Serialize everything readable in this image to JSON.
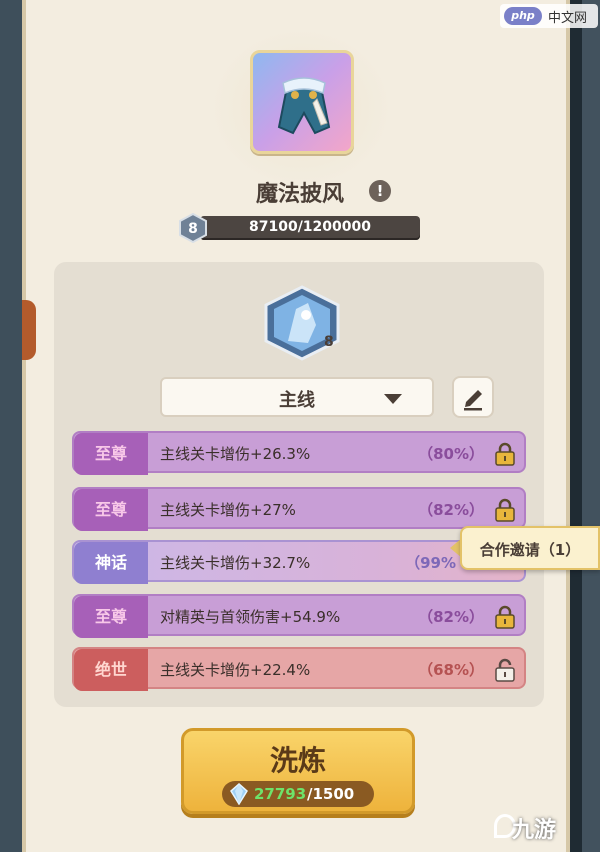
{
  "item": {
    "name": "魔法披风",
    "info_glyph": "!",
    "level": "8",
    "exp_text": "87100/1200000"
  },
  "skill": {
    "level": "8"
  },
  "dropdown": {
    "selected": "主线"
  },
  "attributes": [
    {
      "tier": "至尊",
      "text": "主线关卡增伤+26.3%",
      "pct": "（80%）",
      "locked": true
    },
    {
      "tier": "至尊",
      "text": "主线关卡增伤+27%",
      "pct": "（82%）",
      "locked": true
    },
    {
      "tier": "神话",
      "text": "主线关卡增伤+32.7%",
      "pct": "（99%",
      "locked": true
    },
    {
      "tier": "至尊",
      "text": "对精英与首领伤害+54.9%",
      "pct": "（82%）",
      "locked": true
    },
    {
      "tier": "绝世",
      "text": "主线关卡增伤+22.4%",
      "pct": "（68%）",
      "locked": false
    }
  ],
  "popup": {
    "label": "合作邀请（1）"
  },
  "refine": {
    "label": "洗炼",
    "have": "27793",
    "need": "/1500"
  },
  "watermark": {
    "top_logo": "php",
    "top_text": "中文网",
    "bottom_text": "九游"
  },
  "colors": {
    "gold": "#eeb33c",
    "purple": "#a760b8",
    "violet": "#8f7fd0",
    "red": "#cc5e5e"
  }
}
